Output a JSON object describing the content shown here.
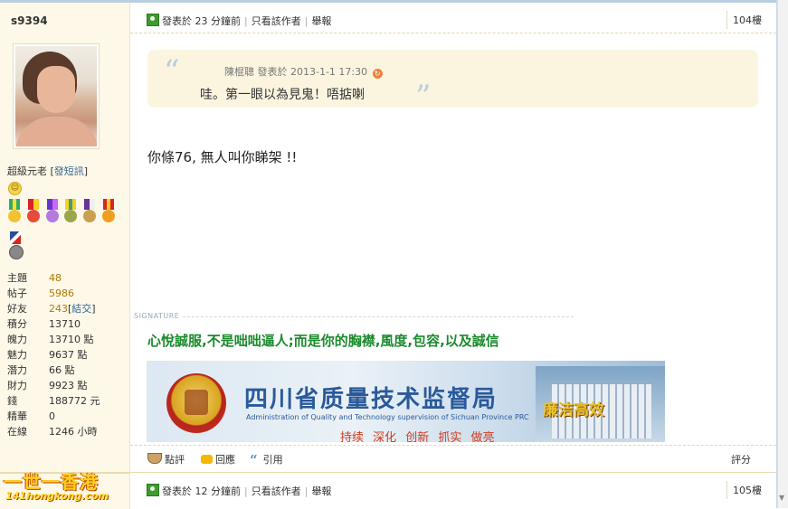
{
  "user": {
    "name": "s9394",
    "rank": "超級元老",
    "pm_link": "發短訊",
    "stats": [
      {
        "k": "主題",
        "v": "48",
        "link": true
      },
      {
        "k": "帖子",
        "v": "5986",
        "link": true
      },
      {
        "k": "好友",
        "v": "243",
        "link": true,
        "extra": "結交"
      },
      {
        "k": "積分",
        "v": "13710"
      },
      {
        "k": "魄力",
        "v": "13710 點"
      },
      {
        "k": "魅力",
        "v": "9637 點"
      },
      {
        "k": "潛力",
        "v": "66 點"
      },
      {
        "k": "財力",
        "v": "9923 點"
      },
      {
        "k": "錢",
        "v": "188772 元"
      },
      {
        "k": "精華",
        "v": "0"
      },
      {
        "k": "在線",
        "v": "1246 小時"
      }
    ]
  },
  "post": {
    "posted": "發表於 23 分鐘前",
    "only_author": "只看該作者",
    "report": "舉報",
    "floor": "104樓",
    "quote": {
      "author": "陳棍聰",
      "posted": "發表於 2013-1-1 17:30",
      "text": "哇。第一眼以為見鬼！唔掂喇"
    },
    "message": "你條76, 無人叫你睇架 !!",
    "signature_label": "SIGNATURE",
    "signature_text": "心悅誠服,不是咄咄逼人;而是你的胸襟,風度,包容,以及誠信",
    "banner": {
      "title": "四川省质量技术监督局",
      "subtitle": "Administration of Quality and Technology supervision of Sichuan Province PRC",
      "slogan": "持续 深化 创新 抓实 做亮",
      "stamp": "廉洁高效"
    },
    "actions": {
      "rate": "點評",
      "reply": "回應",
      "quote": "引用",
      "rate_right": "評分"
    }
  },
  "next_post": {
    "posted": "發表於 12 分鐘前",
    "only_author": "只看該作者",
    "report": "舉報",
    "floor": "105樓"
  },
  "logo": {
    "line1": "一世一香港",
    "line2": "141hongkong.com"
  }
}
